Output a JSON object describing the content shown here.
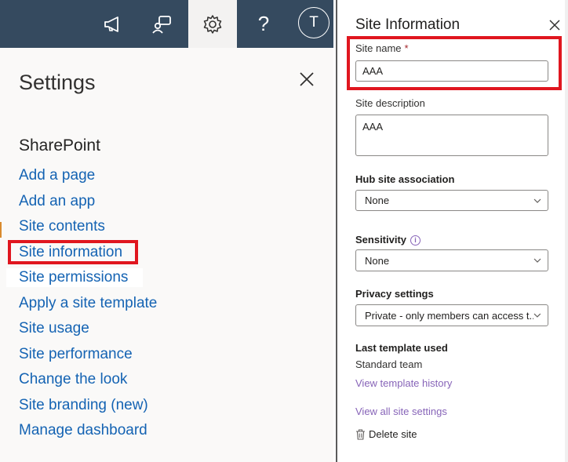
{
  "topbar": {
    "icons": [
      "megaphone-icon",
      "chat-icon",
      "gear-icon",
      "help-icon"
    ],
    "help_label": "?",
    "avatar_initial": "T"
  },
  "settings": {
    "title": "Settings",
    "section": "SharePoint",
    "links": [
      "Add a page",
      "Add an app",
      "Site contents",
      "Site information",
      "Site permissions",
      "Apply a site template",
      "Site usage",
      "Site performance",
      "Change the look",
      "Site branding (new)",
      "Manage dashboard"
    ]
  },
  "panel": {
    "title": "Site Information",
    "site_name_label": "Site name",
    "required_mark": "*",
    "site_name_value": "AAA",
    "site_description_label": "Site description",
    "site_description_value": "AAA",
    "hub_label": "Hub site association",
    "hub_value": "None",
    "sensitivity_label": "Sensitivity",
    "sensitivity_info": "i",
    "sensitivity_value": "None",
    "privacy_label": "Privacy settings",
    "privacy_value": "Private - only members can access t...",
    "last_template_label": "Last template used",
    "last_template_value": "Standard team",
    "view_template_history": "View template history",
    "view_all_settings": "View all site settings",
    "delete_site": "Delete site"
  },
  "colors": {
    "topbar": "#354a5f",
    "link": "#1463b3",
    "highlight": "#e0161f",
    "panel_link": "#8764b8"
  }
}
